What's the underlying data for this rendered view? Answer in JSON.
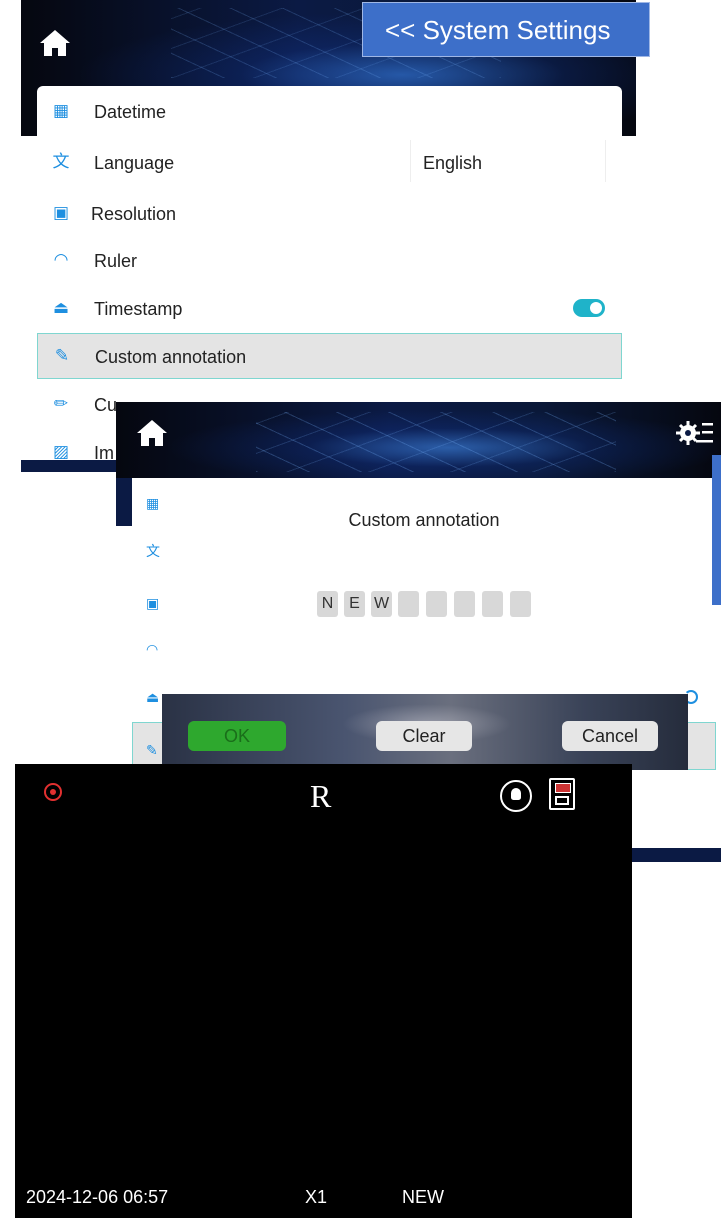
{
  "settings": {
    "title": "<< System Settings",
    "items": [
      {
        "label": "Datetime",
        "icon": "calendar-icon"
      },
      {
        "label": "Language",
        "icon": "language-icon",
        "value": "English"
      },
      {
        "label": "Resolution",
        "icon": "resolution-icon"
      },
      {
        "label": "Ruler",
        "icon": "ruler-icon"
      },
      {
        "label": "Timestamp",
        "icon": "timestamp-icon",
        "toggle": true
      },
      {
        "label": "Custom annotation",
        "icon": "pencil-icon",
        "selected": true
      },
      {
        "label": "Cu",
        "icon": "pen-icon"
      },
      {
        "label": "Im",
        "icon": "image-icon"
      }
    ]
  },
  "dialog": {
    "title": "Custom annotation",
    "chars": [
      "N",
      "E",
      "W",
      "",
      "",
      "",
      "",
      ""
    ],
    "ok_label": "OK",
    "clear_label": "Clear",
    "cancel_label": "Cancel"
  },
  "camera": {
    "mark": "R",
    "datetime": "2024-12-06 06:57",
    "zoom": "X1",
    "annotation": "NEW"
  },
  "colors": {
    "accent": "#1e8fe0",
    "header_blue": "#3d6fc9",
    "toggle_on": "#1fb3c9",
    "ok_green": "#2ea82e",
    "record_red": "#e23030"
  }
}
